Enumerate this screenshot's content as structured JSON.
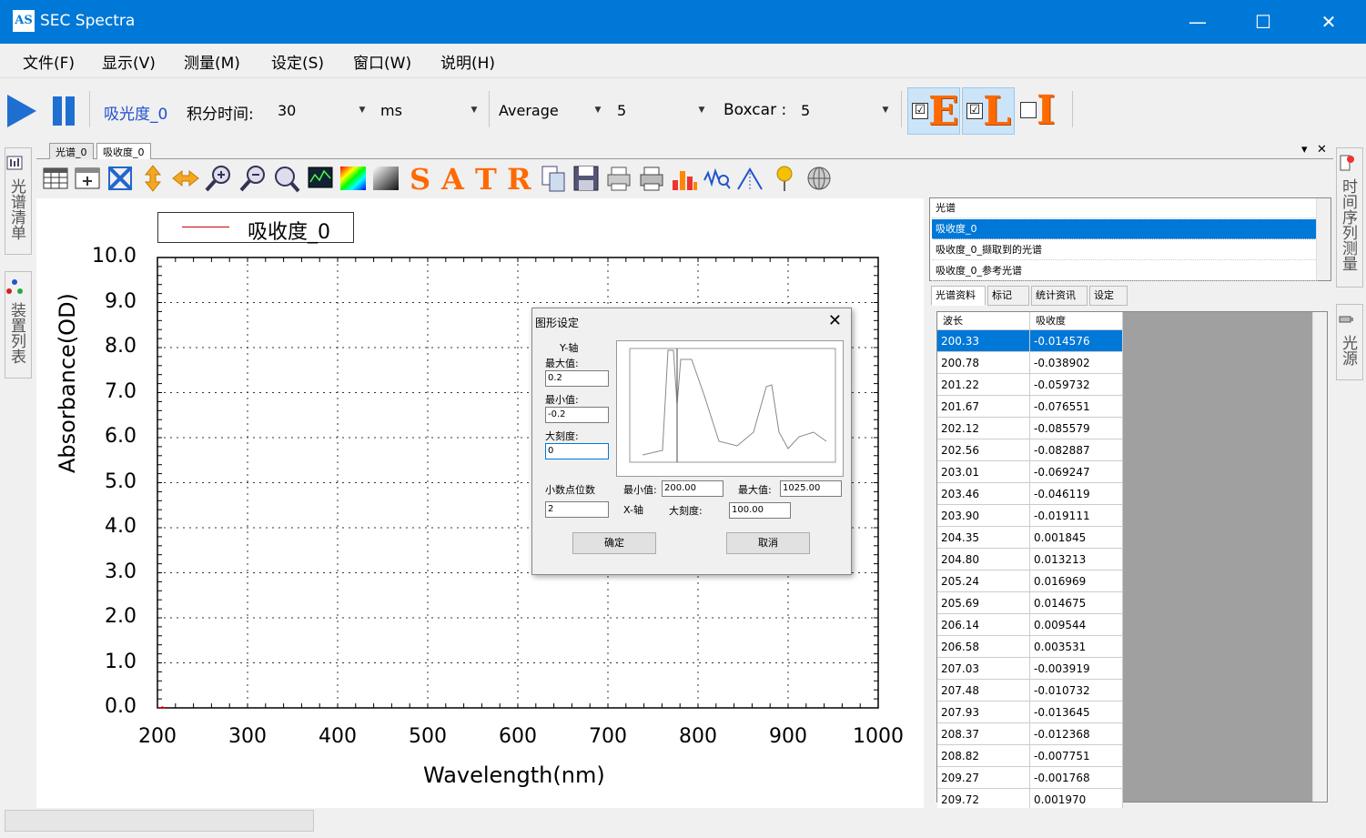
{
  "window": {
    "logo": "AS",
    "title": "SEC Spectra",
    "minimize_glyph": "—",
    "maximize_glyph": "☐",
    "close_glyph": "✕"
  },
  "menu": [
    "文件(F)",
    "显示(V)",
    "测量(M)",
    "设定(S)",
    "窗口(W)",
    "说明(H)"
  ],
  "toolbar": {
    "mode_label": "吸光度_0",
    "integration_label": "积分时间:",
    "integration_value": "30",
    "unit_value": "ms",
    "average_label": "Average",
    "average_value": "5",
    "boxcar_label": "Boxcar :",
    "boxcar_value": "5",
    "check_glyph": "☑",
    "eli": [
      {
        "letter": "E",
        "checked": true
      },
      {
        "letter": "L",
        "checked": true
      },
      {
        "letter": "I",
        "checked": false
      }
    ]
  },
  "left_tabs": [
    "光谱清单",
    "装置列表"
  ],
  "right_tabs": [
    "时间序列测量",
    "光源"
  ],
  "doc_tabs": [
    "光谱_0",
    "吸收度_0"
  ],
  "doc_controls": [
    "▾",
    "✕"
  ],
  "chart_toolbar_letters": [
    "S",
    "A",
    "T",
    "R"
  ],
  "chart_data": {
    "type": "line",
    "xlabel": "Wavelength(nm)",
    "ylabel": "Absorbance(OD)",
    "xlim": [
      200,
      1000
    ],
    "ylim": [
      0.0,
      10.0
    ],
    "xticks": [
      "200",
      "300",
      "400",
      "500",
      "600",
      "700",
      "800",
      "900",
      "1000"
    ],
    "yticks": [
      "0.0",
      "1.0",
      "2.0",
      "3.0",
      "4.0",
      "5.0",
      "6.0",
      "7.0",
      "8.0",
      "9.0",
      "10.0"
    ],
    "grid": true,
    "legend_position": "top-left",
    "series": [
      {
        "name": "吸收度_0",
        "color": "#c00000",
        "x": [
          200.33,
          204.35,
          205.24,
          206.14,
          209.72
        ],
        "y": [
          0.0,
          0.0,
          0.02,
          0.01,
          0.0
        ]
      }
    ]
  },
  "dialog": {
    "title": "图形设定",
    "close_glyph": "✕",
    "y_axis_label": "Y-轴",
    "max_label": "最大值:",
    "max_value": "0.2",
    "min_label": "最小值:",
    "min_value": "-0.2",
    "major_label": "大刻度:",
    "major_value": "0",
    "decimals_label": "小数点位数",
    "decimals_value": "2",
    "x_axis_label": "X-轴",
    "x_min_label": "最小值:",
    "x_min_value": "200.00",
    "x_max_label": "最大值:",
    "x_max_value": "1025.00",
    "x_major_label": "大刻度:",
    "x_major_value": "100.00",
    "ok_label": "确定",
    "cancel_label": "取消"
  },
  "spectrum_list": {
    "items": [
      "光谱",
      "吸收度_0",
      "吸收度_0_撷取到的光谱",
      "吸收度_0_参考光谱"
    ],
    "selected": 1
  },
  "panel_tabs": [
    "光谱资料",
    "标记",
    "统计资讯",
    "设定"
  ],
  "data_table": {
    "headers": [
      "波长",
      "吸收度"
    ],
    "rows": [
      [
        "200.33",
        "-0.014576"
      ],
      [
        "200.78",
        "-0.038902"
      ],
      [
        "201.22",
        "-0.059732"
      ],
      [
        "201.67",
        "-0.076551"
      ],
      [
        "202.12",
        "-0.085579"
      ],
      [
        "202.56",
        "-0.082887"
      ],
      [
        "203.01",
        "-0.069247"
      ],
      [
        "203.46",
        "-0.046119"
      ],
      [
        "203.90",
        "-0.019111"
      ],
      [
        "204.35",
        "0.001845"
      ],
      [
        "204.80",
        "0.013213"
      ],
      [
        "205.24",
        "0.016969"
      ],
      [
        "205.69",
        "0.014675"
      ],
      [
        "206.14",
        "0.009544"
      ],
      [
        "206.58",
        "0.003531"
      ],
      [
        "207.03",
        "-0.003919"
      ],
      [
        "207.48",
        "-0.010732"
      ],
      [
        "207.93",
        "-0.013645"
      ],
      [
        "208.37",
        "-0.012368"
      ],
      [
        "208.82",
        "-0.007751"
      ],
      [
        "209.27",
        "-0.001768"
      ],
      [
        "209.72",
        "0.001970"
      ]
    ],
    "selected_row": 0
  },
  "colors": {
    "titlebar": "#0078d7",
    "selection": "#0078d7",
    "accent_orange": "#ff6a00",
    "play_blue": "#1f6fd1"
  }
}
